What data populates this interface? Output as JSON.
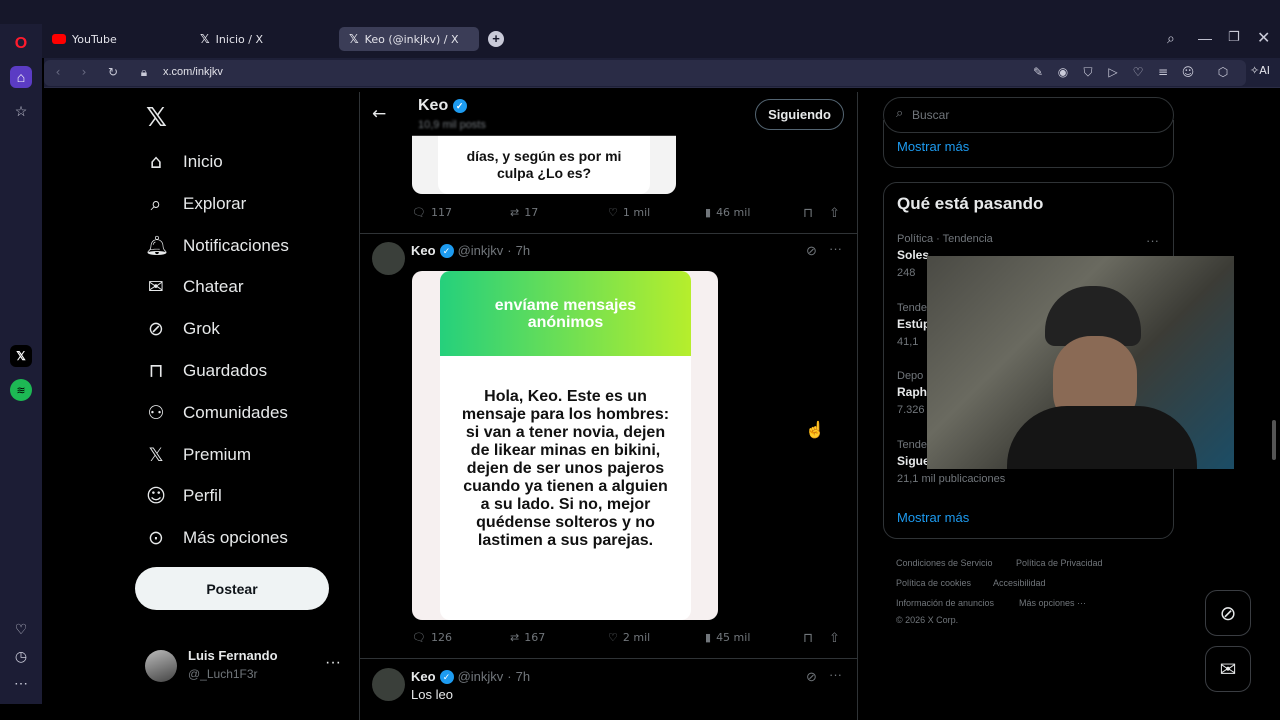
{
  "browser": {
    "tabs": [
      {
        "label": "YouTube",
        "icon": "youtube-icon"
      },
      {
        "label": "Inicio / X",
        "icon": "x-logo-icon"
      },
      {
        "label": "Keo (@inkjkv) / X",
        "icon": "x-logo-icon"
      }
    ],
    "url": "x.com/inkjkv",
    "ai_label": "AI"
  },
  "nav": {
    "items": [
      {
        "label": "Inicio",
        "icon": "home-icon"
      },
      {
        "label": "Explorar",
        "icon": "search-icon"
      },
      {
        "label": "Notificaciones",
        "icon": "bell-icon"
      },
      {
        "label": "Chatear",
        "icon": "mail-icon"
      },
      {
        "label": "Grok",
        "icon": "grok-icon"
      },
      {
        "label": "Guardados",
        "icon": "bookmark-icon"
      },
      {
        "label": "Comunidades",
        "icon": "communities-icon"
      },
      {
        "label": "Premium",
        "icon": "x-logo-icon"
      },
      {
        "label": "Perfil",
        "icon": "person-icon"
      },
      {
        "label": "Más opciones",
        "icon": "more-circle-icon"
      }
    ],
    "post_button": "Postear",
    "account": {
      "name": "Luis Fernando",
      "handle": "@_Luch1F3r"
    }
  },
  "profile_header": {
    "name": "Keo",
    "posts": "10,9 mil posts",
    "follow_button": "Siguiendo"
  },
  "tweets": [
    {
      "image_text": "días, y según es por mi culpa ¿Lo es?",
      "replies": "117",
      "reposts": "17",
      "likes": "1 mil",
      "views": "46 mil"
    },
    {
      "name": "Keo",
      "handle": "@inkjkv",
      "time": "7h",
      "card_header": "envíame mensajes anónimos",
      "card_body": "Hola, Keo. Este es un mensaje para los hombres: si van a tener novia, dejen de likear minas en bikini, dejen de ser unos pajeros cuando ya tienen a alguien a su lado. Si no, mejor quédense solteros y no lastimen a sus parejas.",
      "replies": "126",
      "reposts": "167",
      "likes": "2 mil",
      "views": "45 mil"
    },
    {
      "name": "Keo",
      "handle": "@inkjkv",
      "time": "7h",
      "text": "Los leo"
    }
  ],
  "sidebar": {
    "search_placeholder": "Buscar",
    "show_more_top": "Mostrar más",
    "trends_title": "Qué está pasando",
    "trends": [
      {
        "category": "Política · Tendencia",
        "name": "Soles",
        "count": "248"
      },
      {
        "category": "Tende",
        "name": "Estúp",
        "count": "41,1"
      },
      {
        "category": "Depo",
        "name": "Raph",
        "count": "7.326"
      },
      {
        "category": "Tende",
        "name": "Sigue",
        "count": "21,1 mil publicaciones"
      }
    ],
    "show_more_bottom": "Mostrar más",
    "footer": {
      "links": [
        "Condiciones de Servicio",
        "Política de Privacidad",
        "Política de cookies",
        "Accesibilidad",
        "Información de anuncios",
        "Más opciones ···"
      ],
      "copyright": "© 2026 X Corp."
    }
  },
  "colors": {
    "accent": "#1d9bf0",
    "card_green_top": "#25d07c",
    "card_green_bottom": "#b6ee2c"
  }
}
